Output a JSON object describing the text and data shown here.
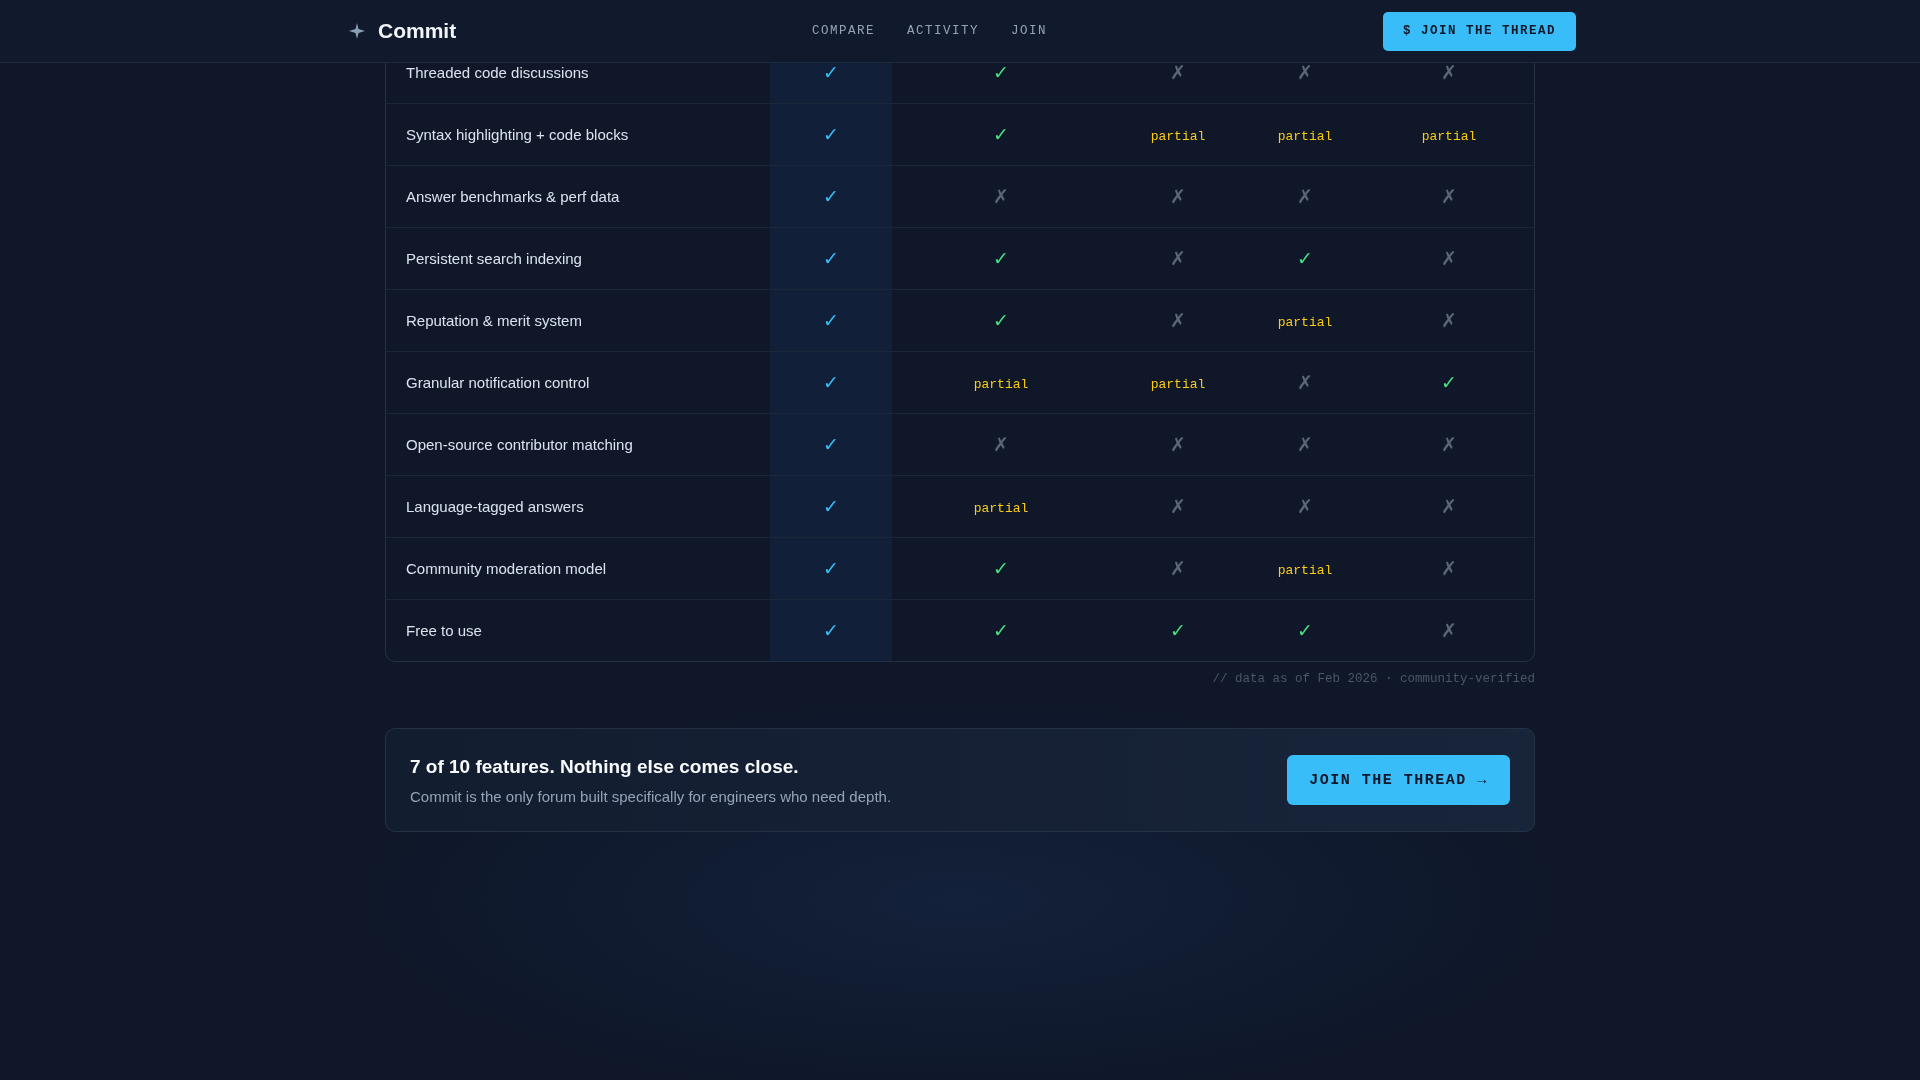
{
  "header": {
    "brand": "Commit",
    "nav": [
      {
        "label": "COMPARE"
      },
      {
        "label": "ACTIVITY"
      },
      {
        "label": "JOIN"
      }
    ],
    "cta": "$ JOIN THE THREAD"
  },
  "table": {
    "rows": [
      {
        "feature": "Threaded code discussions",
        "cells": [
          {
            "kind": "yes",
            "text": "✓"
          },
          {
            "kind": "yes",
            "text": "✓"
          },
          {
            "kind": "no",
            "text": "✗"
          },
          {
            "kind": "no",
            "text": "✗"
          },
          {
            "kind": "no",
            "text": "✗"
          }
        ]
      },
      {
        "feature": "Syntax highlighting + code blocks",
        "cells": [
          {
            "kind": "yes",
            "text": "✓"
          },
          {
            "kind": "yes",
            "text": "✓"
          },
          {
            "kind": "partial",
            "text": "partial"
          },
          {
            "kind": "partial",
            "text": "partial"
          },
          {
            "kind": "partial",
            "text": "partial"
          }
        ]
      },
      {
        "feature": "Answer benchmarks & perf data",
        "cells": [
          {
            "kind": "yes",
            "text": "✓"
          },
          {
            "kind": "no",
            "text": "✗"
          },
          {
            "kind": "no",
            "text": "✗"
          },
          {
            "kind": "no",
            "text": "✗"
          },
          {
            "kind": "no",
            "text": "✗"
          }
        ]
      },
      {
        "feature": "Persistent search indexing",
        "cells": [
          {
            "kind": "yes",
            "text": "✓"
          },
          {
            "kind": "yes",
            "text": "✓"
          },
          {
            "kind": "no",
            "text": "✗"
          },
          {
            "kind": "yes",
            "text": "✓"
          },
          {
            "kind": "no",
            "text": "✗"
          }
        ]
      },
      {
        "feature": "Reputation & merit system",
        "cells": [
          {
            "kind": "yes",
            "text": "✓"
          },
          {
            "kind": "yes",
            "text": "✓"
          },
          {
            "kind": "no",
            "text": "✗"
          },
          {
            "kind": "partial",
            "text": "partial"
          },
          {
            "kind": "no",
            "text": "✗"
          }
        ]
      },
      {
        "feature": "Granular notification control",
        "cells": [
          {
            "kind": "yes",
            "text": "✓"
          },
          {
            "kind": "partial",
            "text": "partial"
          },
          {
            "kind": "partial",
            "text": "partial"
          },
          {
            "kind": "no",
            "text": "✗"
          },
          {
            "kind": "yes",
            "text": "✓"
          }
        ]
      },
      {
        "feature": "Open-source contributor matching",
        "cells": [
          {
            "kind": "yes",
            "text": "✓"
          },
          {
            "kind": "no",
            "text": "✗"
          },
          {
            "kind": "no",
            "text": "✗"
          },
          {
            "kind": "no",
            "text": "✗"
          },
          {
            "kind": "no",
            "text": "✗"
          }
        ]
      },
      {
        "feature": "Language-tagged answers",
        "cells": [
          {
            "kind": "yes",
            "text": "✓"
          },
          {
            "kind": "partial",
            "text": "partial"
          },
          {
            "kind": "no",
            "text": "✗"
          },
          {
            "kind": "no",
            "text": "✗"
          },
          {
            "kind": "no",
            "text": "✗"
          }
        ]
      },
      {
        "feature": "Community moderation model",
        "cells": [
          {
            "kind": "yes",
            "text": "✓"
          },
          {
            "kind": "yes",
            "text": "✓"
          },
          {
            "kind": "no",
            "text": "✗"
          },
          {
            "kind": "partial",
            "text": "partial"
          },
          {
            "kind": "no",
            "text": "✗"
          }
        ]
      },
      {
        "feature": "Free to use",
        "cells": [
          {
            "kind": "yes",
            "text": "✓"
          },
          {
            "kind": "yes",
            "text": "✓"
          },
          {
            "kind": "yes",
            "text": "✓"
          },
          {
            "kind": "yes",
            "text": "✓"
          },
          {
            "kind": "no",
            "text": "✗"
          }
        ]
      }
    ],
    "footnote": "// data as of Feb 2026 · community-verified"
  },
  "cta_card": {
    "title": "7 of 10 features. Nothing else comes close.",
    "text": "Commit is the only forum built specifically for engineers who need depth.",
    "button": "JOIN THE THREAD →"
  }
}
